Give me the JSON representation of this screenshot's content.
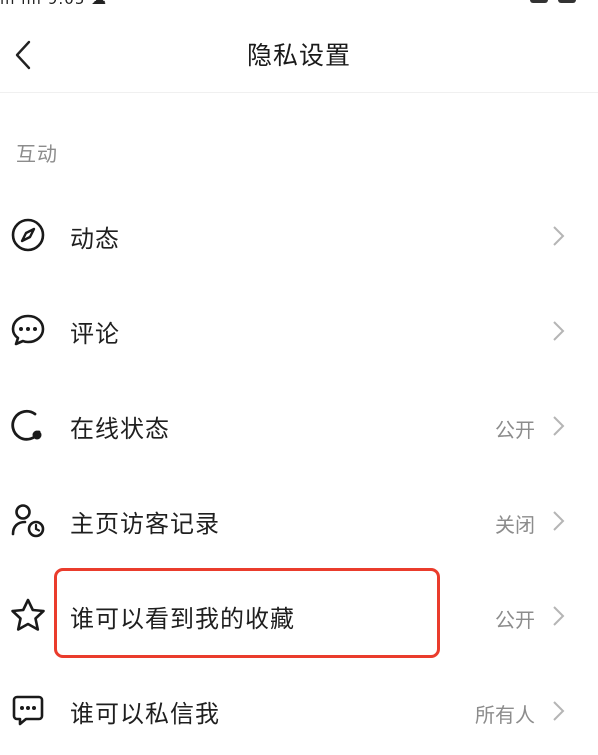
{
  "statusbar": {
    "left_text": "ııl ıııl 9:05 ☁",
    "right_text": ""
  },
  "header": {
    "title": "隐私设置"
  },
  "section": {
    "title": "互动"
  },
  "rows": [
    {
      "label": "动态",
      "value": "",
      "icon": "compass-icon"
    },
    {
      "label": "评论",
      "value": "",
      "icon": "comment-bubble-icon"
    },
    {
      "label": "在线状态",
      "value": "公开",
      "icon": "online-status-icon"
    },
    {
      "label": "主页访客记录",
      "value": "关闭",
      "icon": "visitor-clock-icon"
    },
    {
      "label": "谁可以看到我的收藏",
      "value": "公开",
      "icon": "star-icon"
    },
    {
      "label": "谁可以私信我",
      "value": "所有人",
      "icon": "message-icon"
    }
  ],
  "colors": {
    "highlight": "#ea3c2c",
    "secondary_text": "#8c8c8c",
    "chevron": "#b5b5b5"
  }
}
